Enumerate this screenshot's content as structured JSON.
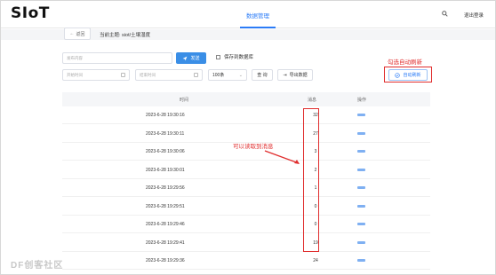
{
  "app": {
    "logo": "SIoT",
    "nav_tab": "数据管理",
    "logout": "退出登录"
  },
  "subbar": {
    "back_label": "返回",
    "topic_label": "当前主题: siot/土壤湿度"
  },
  "controls": {
    "content_placeholder": "发布内容",
    "send_label": "发送",
    "save_checkbox_label": "保存到数据库",
    "start_time_placeholder": "开始时间",
    "end_time_placeholder": "结束时间",
    "count_select": "100条",
    "query_label": "查 询",
    "export_label": "导出数据",
    "auto_refresh_label": "自动刷新"
  },
  "annotations": {
    "auto_refresh": "勾选自动刷新",
    "read_message": "可以读取到消息"
  },
  "table": {
    "headers": {
      "time": "时间",
      "message": "消息",
      "operation": "操作"
    },
    "rows": [
      {
        "time": "2023-6-28 19:30:16",
        "message": "32"
      },
      {
        "time": "2023-6-28 19:30:11",
        "message": "27"
      },
      {
        "time": "2023-6-28 19:30:06",
        "message": "3"
      },
      {
        "time": "2023-6-28 19:30:01",
        "message": "2"
      },
      {
        "time": "2023-6-28 19:29:56",
        "message": "1"
      },
      {
        "time": "2023-6-28 19:29:51",
        "message": "0"
      },
      {
        "time": "2023-6-28 19:29:46",
        "message": "0"
      },
      {
        "time": "2023-6-28 19:29:41",
        "message": "19"
      },
      {
        "time": "2023-6-28 19:29:36",
        "message": "24"
      }
    ]
  },
  "watermark": "DF创客社区",
  "colors": {
    "accent": "#2b7cf7",
    "annotation": "#e02d2d"
  }
}
